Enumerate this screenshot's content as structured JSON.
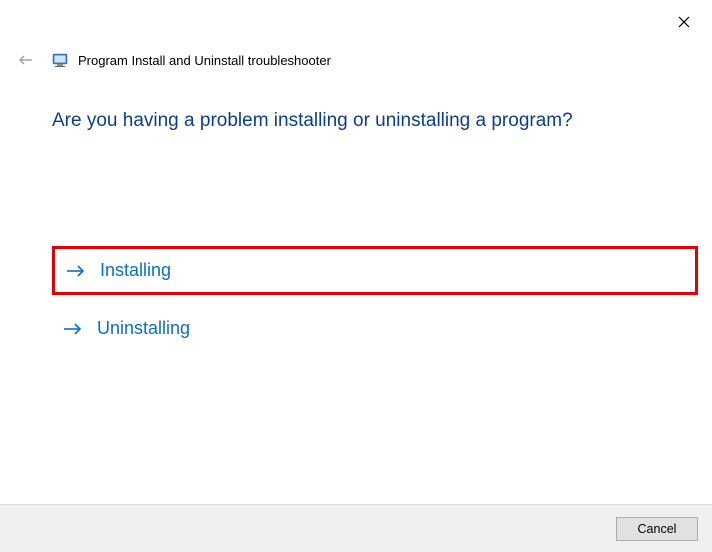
{
  "header": {
    "title": "Program Install and Uninstall troubleshooter"
  },
  "main": {
    "question": "Are you having a problem installing or uninstalling a program?"
  },
  "options": [
    {
      "label": "Installing",
      "highlighted": true
    },
    {
      "label": "Uninstalling",
      "highlighted": false
    }
  ],
  "footer": {
    "cancel_label": "Cancel"
  }
}
